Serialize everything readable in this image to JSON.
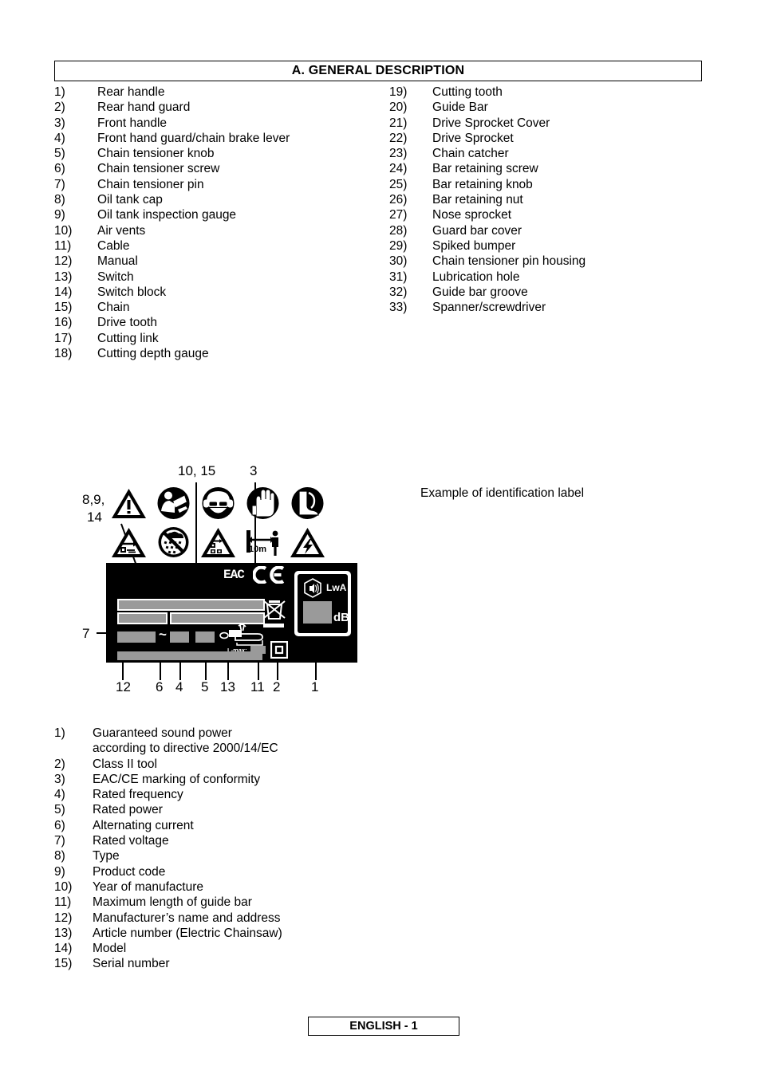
{
  "heading": {
    "title": "A. GENERAL DESCRIPTION"
  },
  "parts_list": {
    "left": [
      {
        "num": "1)",
        "label": "Rear handle"
      },
      {
        "num": "2)",
        "label": "Rear hand guard"
      },
      {
        "num": "3)",
        "label": "Front handle"
      },
      {
        "num": "4)",
        "label": "Front hand guard/chain brake lever"
      },
      {
        "num": "5)",
        "label": "Chain tensioner knob"
      },
      {
        "num": "6)",
        "label": "Chain tensioner screw"
      },
      {
        "num": "7)",
        "label": "Chain tensioner pin"
      },
      {
        "num": "8)",
        "label": "Oil tank cap"
      },
      {
        "num": "9)",
        "label": "Oil tank inspection gauge"
      },
      {
        "num": "10)",
        "label": "Air vents"
      },
      {
        "num": "11)",
        "label": "Cable"
      },
      {
        "num": "12)",
        "label": "Manual"
      },
      {
        "num": "13)",
        "label": "Switch"
      },
      {
        "num": "14)",
        "label": "Switch block"
      },
      {
        "num": "15)",
        "label": "Chain"
      },
      {
        "num": "16)",
        "label": "Drive tooth"
      },
      {
        "num": "17)",
        "label": "Cutting link"
      },
      {
        "num": "18)",
        "label": "Cutting depth gauge"
      }
    ],
    "right": [
      {
        "num": "19)",
        "label": "Cutting tooth"
      },
      {
        "num": "20)",
        "label": "Guide Bar"
      },
      {
        "num": "21)",
        "label": "Drive Sprocket Cover"
      },
      {
        "num": "22)",
        "label": "Drive Sprocket"
      },
      {
        "num": "23)",
        "label": "Chain catcher"
      },
      {
        "num": "24)",
        "label": "Bar retaining screw"
      },
      {
        "num": "25)",
        "label": "Bar retaining knob"
      },
      {
        "num": "26)",
        "label": "Bar retaining nut"
      },
      {
        "num": "27)",
        "label": "Nose sprocket"
      },
      {
        "num": "28)",
        "label": "Guard bar cover"
      },
      {
        "num": "29)",
        "label": "Spiked bumper"
      },
      {
        "num": "30)",
        "label": "Chain tensioner pin housing"
      },
      {
        "num": "31)",
        "label": "Lubrication hole"
      },
      {
        "num": "32)",
        "label": "Guide bar groove"
      },
      {
        "num": "33)",
        "label": "Spanner/screwdriver"
      }
    ]
  },
  "figure": {
    "caption": "Example of identification label",
    "callouts": {
      "top_left": "8,9,",
      "top_left2": "14",
      "top_mid": "10, 15",
      "top_right": "3",
      "left_side": "7",
      "bottom": [
        "12",
        "6",
        "4",
        "5",
        "13",
        "11",
        "2",
        "1"
      ]
    },
    "label_marks": {
      "eac": "EAC",
      "ce": "CE",
      "lwa": "LwA",
      "db": "dB",
      "lmax": "L-max:",
      "ac": "~",
      "distance": "10m"
    },
    "pictograms": [
      "warning-triangle-icon",
      "read-manual-icon",
      "face-eye-ear-protection-icon",
      "wear-gloves-icon",
      "wear-boots-icon",
      "kickback-warning-icon",
      "no-rain-icon",
      "two-hands-warning-icon",
      "keep-distance-10m-icon",
      "electric-shock-warning-icon"
    ]
  },
  "legend": {
    "items": [
      {
        "num": "1)",
        "label": "Guaranteed sound power",
        "cont": "according to directive 2000/14/EC"
      },
      {
        "num": "2)",
        "label": "Class II tool"
      },
      {
        "num": "3)",
        "label": "EAC/CE marking of conformity"
      },
      {
        "num": "4)",
        "label": "Rated frequency"
      },
      {
        "num": "5)",
        "label": "Rated power"
      },
      {
        "num": "6)",
        "label": "Alternating current"
      },
      {
        "num": "7)",
        "label": "Rated voltage"
      },
      {
        "num": "8)",
        "label": "Type"
      },
      {
        "num": "9)",
        "label": "Product code"
      },
      {
        "num": "10)",
        "label": "Year of manufacture"
      },
      {
        "num": "11)",
        "label": "Maximum length of guide bar"
      },
      {
        "num": "12)",
        "label": "Manufacturer’s name and address"
      },
      {
        "num": "13)",
        "label": "Article number (Electric Chainsaw)"
      },
      {
        "num": "14)",
        "label": "Model"
      },
      {
        "num": "15)",
        "label": "Serial number"
      }
    ]
  },
  "footer": {
    "text": "ENGLISH - 1"
  }
}
